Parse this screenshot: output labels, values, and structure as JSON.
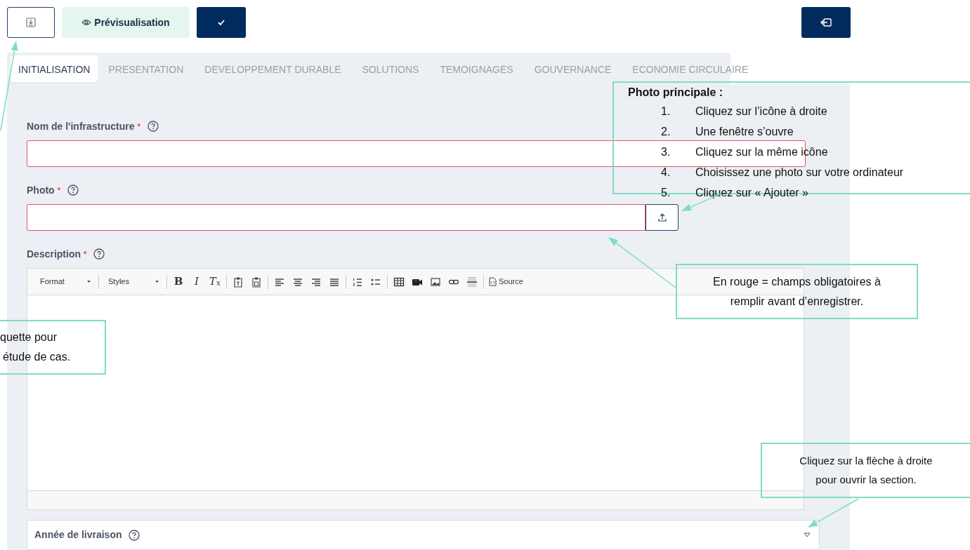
{
  "top_bar": {
    "preview_button": {
      "label": "Prévisualisation"
    }
  },
  "tabs": [
    {
      "label": "INITIALISATION",
      "selected": true
    },
    {
      "label": "PRESENTATION",
      "selected": false
    },
    {
      "label": "DEVELOPPEMENT DURABLE",
      "selected": false
    },
    {
      "label": "SOLUTIONS",
      "selected": false
    },
    {
      "label": "TEMOIGNAGES",
      "selected": false
    },
    {
      "label": "GOUVERNANCE",
      "selected": false
    },
    {
      "label": "ECONOMIE CIRCULAIRE",
      "selected": false
    }
  ],
  "fields": [
    {
      "kind": "text",
      "label": "Nom de l'infrastructure",
      "required_mark": "*",
      "invalid": true
    },
    {
      "kind": "upload",
      "label": "Photo",
      "required_mark": "*",
      "invalid": true
    },
    {
      "kind": "editor",
      "label": "Description",
      "required_mark": "*",
      "invalid": false,
      "toolbar": [
        {
          "kind": "dropdown",
          "label": "Format"
        },
        {
          "kind": "dropdown",
          "label": "Styles"
        },
        {
          "kind": "bold",
          "text": "B"
        },
        {
          "kind": "italic",
          "text": "I"
        },
        {
          "kind": "clear",
          "text": "T$_{x}$"
        },
        {
          "kind": "source",
          "label": "Source"
        }
      ]
    }
  ],
  "accordion": {
    "label": "Année de livraison",
    "expanded": false
  },
  "callouts": [
    {
      "kind": "steps",
      "title": "Photo principale :",
      "steps": [
        {
          "number": "1.",
          "text": "Cliquez sur l’icône à droite"
        },
        {
          "number": "2.",
          "text": "Une fenêtre s’ouvre"
        },
        {
          "number": "3.",
          "text": "Cliquez sur la même icône"
        },
        {
          "number": "4.",
          "text": "Choisissez une photo sur votre ordinateur"
        },
        {
          "number": "5.",
          "text": "Cliquez sur « Ajouter »"
        }
      ]
    },
    {
      "kind": "note",
      "lines": [
        "En rouge = champs obligatoires à",
        "remplir avant d’enregistrer."
      ]
    },
    {
      "kind": "note",
      "lines": [
        "quette pour",
        "étude de cas."
      ]
    },
    {
      "kind": "note",
      "lines": [
        "Cliquez sur la flèche à droite",
        "pour ouvrir la section."
      ]
    }
  ]
}
